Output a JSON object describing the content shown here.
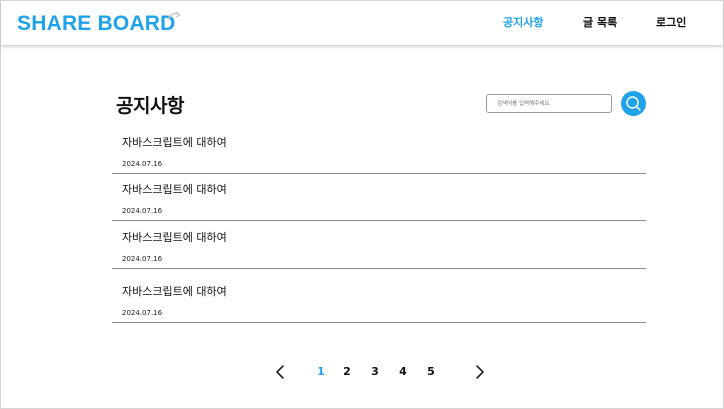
{
  "colors": {
    "accent": "#1ea2ea",
    "text": "#111111",
    "divider": "#8d8d8d"
  },
  "header": {
    "logo": "SHARE BOARD",
    "nav": [
      {
        "label": "공지사항",
        "active": true
      },
      {
        "label": "글 목록",
        "active": false
      },
      {
        "label": "로그인",
        "active": false
      }
    ]
  },
  "main": {
    "title": "공지사항",
    "search": {
      "placeholder": "검색어를 입력해주세요.",
      "icon": "search-icon"
    },
    "posts": [
      {
        "title": "자바스크립트에 대하여",
        "date": "2024.07.16"
      },
      {
        "title": "자바스크립트에 대하여",
        "date": "2024.07.16"
      },
      {
        "title": "자바스크립트에 대하여",
        "date": "2024.07.16"
      },
      {
        "title": "자바스크립트에 대하여",
        "date": "2024.07.16"
      }
    ]
  },
  "pagination": {
    "prev_icon": "chevron-left-icon",
    "next_icon": "chevron-right-icon",
    "pages": [
      "1",
      "2",
      "3",
      "4",
      "5"
    ],
    "current": "1"
  }
}
